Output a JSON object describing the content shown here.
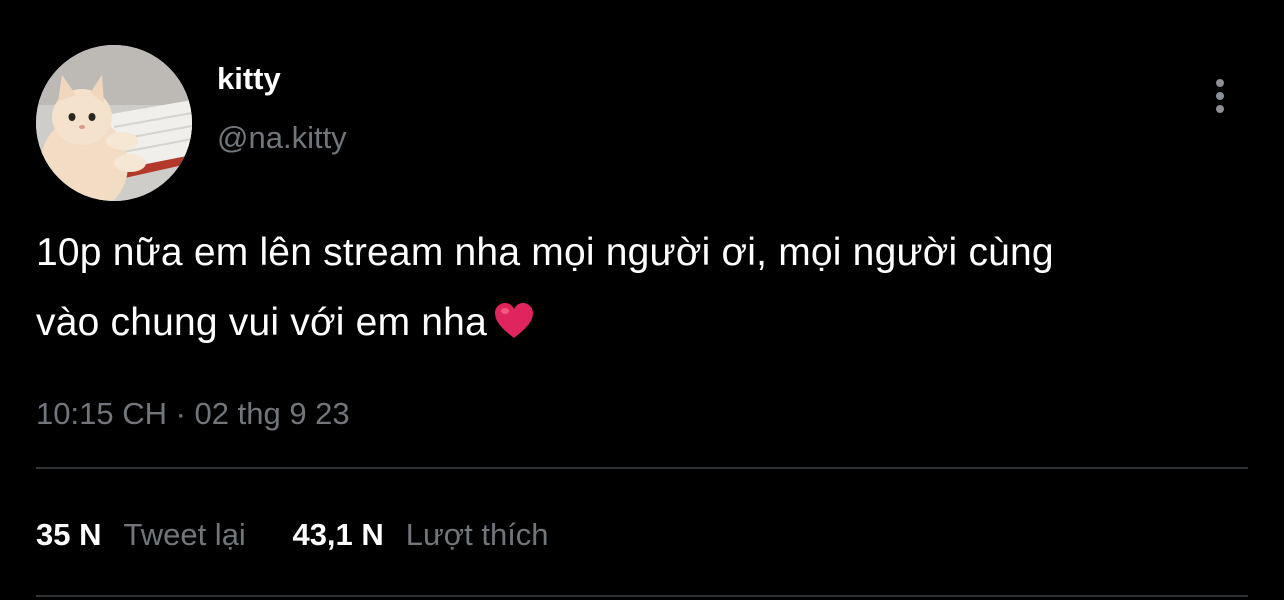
{
  "tweet": {
    "author": {
      "display_name": "kitty",
      "handle": "@na.kitty",
      "avatar_icon": "cat-at-keyboard-avatar"
    },
    "text_line_1": "10p nữa em lên stream nha mọi người ơi, mọi người cùng",
    "text_line_2": "vào chung vui với em nha",
    "emoji": "red-heart",
    "timestamp": "10:15 CH · 02 thg 9 23",
    "more_icon": "more-vertical-icon"
  },
  "stats": {
    "retweets": {
      "count": "35 N",
      "label": "Tweet lại"
    },
    "likes": {
      "count": "43,1 N",
      "label": "Lượt thích"
    }
  },
  "colors": {
    "background": "#000000",
    "primary_text": "#ffffff",
    "secondary_text": "#71767b",
    "divider": "#2f3336",
    "heart": "#e0245e"
  }
}
